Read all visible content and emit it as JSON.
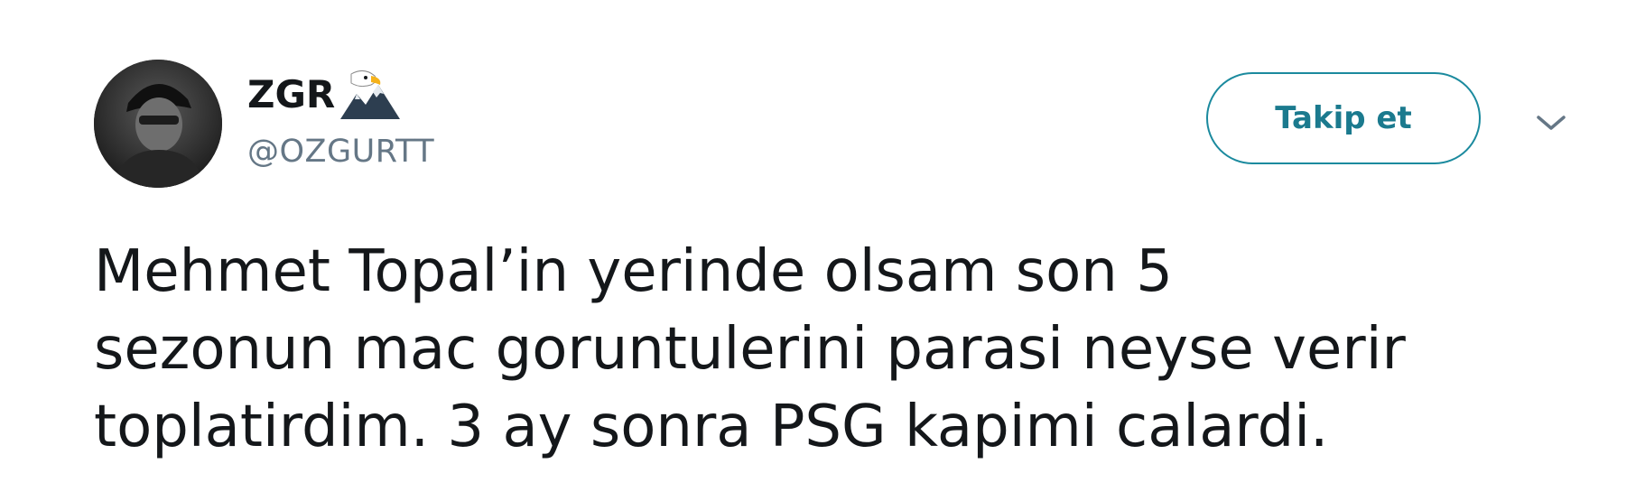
{
  "author": {
    "name": "ZGR",
    "handle": "@OZGURTT",
    "name_emoji_icon": "eagle-mountain-icon",
    "avatar_icon": "user-avatar"
  },
  "follow_button": {
    "label": "Takip et",
    "color": "#1b8a9e"
  },
  "menu": {
    "icon": "chevron-down-icon"
  },
  "tweet": {
    "lines": [
      "Mehmet Topal’in yerinde olsam son 5",
      "sezonun mac goruntulerini parasi neyse verir",
      "toplatirdim. 3 ay sonra PSG kapimi calardi."
    ]
  }
}
